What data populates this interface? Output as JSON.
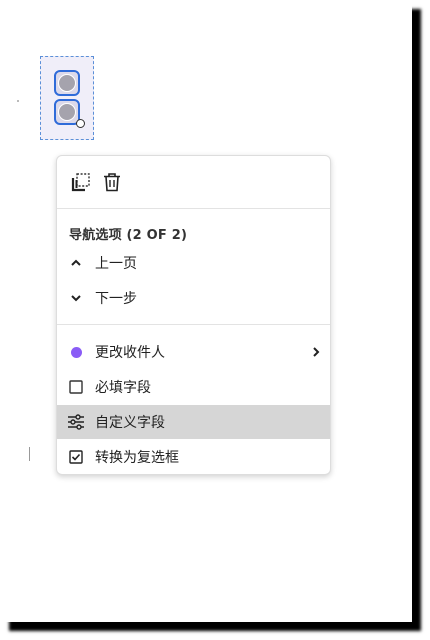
{
  "menu": {
    "toolbar": {
      "duplicate_icon": "duplicate-icon",
      "delete_icon": "trash-icon"
    },
    "section_title": "导航选项 (2 OF 2)",
    "nav_items": [
      {
        "label": "上一页",
        "icon": "chevron-up-icon"
      },
      {
        "label": "下一步",
        "icon": "chevron-down-icon"
      }
    ],
    "items": [
      {
        "label": "更改收件人",
        "icon": "recipient-color-dot",
        "color": "#8a5cf6",
        "has_submenu": true
      },
      {
        "label": "必填字段",
        "icon": "checkbox-unchecked-icon"
      },
      {
        "label": "自定义字段",
        "icon": "sliders-icon",
        "highlighted": true
      },
      {
        "label": "转换为复选框",
        "icon": "checkbox-checked-icon"
      }
    ]
  },
  "colors": {
    "field_border": "#2f6bd9",
    "highlight": "#d6d6d6",
    "recipient": "#8a5cf6"
  }
}
